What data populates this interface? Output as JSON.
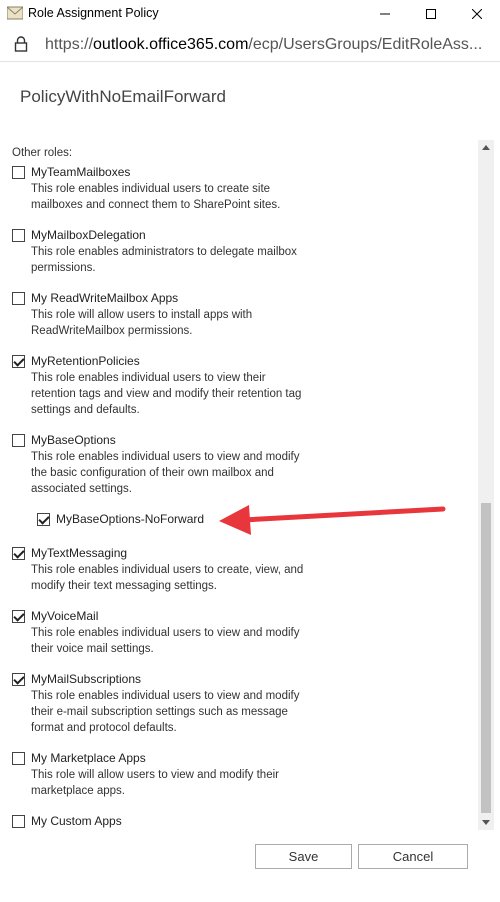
{
  "window": {
    "title": "Role Assignment Policy",
    "minimize_icon": "minimize-icon",
    "maximize_icon": "maximize-icon",
    "close_icon": "close-icon"
  },
  "address_bar": {
    "protocol": "https://",
    "host": "outlook.office365.com",
    "path": "/ecp/UsersGroups/EditRoleAss..."
  },
  "policy_name": "PolicyWithNoEmailForward",
  "section_label": "Other roles:",
  "roles": [
    {
      "name": "MyTeamMailboxes",
      "desc": "This role enables individual users to create site mailboxes and connect them to SharePoint sites.",
      "checked": false
    },
    {
      "name": "MyMailboxDelegation",
      "desc": "This role enables administrators to delegate mailbox permissions.",
      "checked": false
    },
    {
      "name": "My ReadWriteMailbox Apps",
      "desc": "This role will allow users to install apps with ReadWriteMailbox permissions.",
      "checked": false
    },
    {
      "name": "MyRetentionPolicies",
      "desc": "This role enables individual users to view their retention tags and view and modify their retention tag settings and defaults.",
      "checked": true
    },
    {
      "name": "MyBaseOptions",
      "desc": "This role enables individual users to view and modify the basic configuration of their own mailbox and associated settings.",
      "checked": false
    },
    {
      "name": "MyBaseOptions-NoForward",
      "desc": "",
      "checked": true
    },
    {
      "name": "MyTextMessaging",
      "desc": "This role enables individual users to create, view, and modify their text messaging settings.",
      "checked": true
    },
    {
      "name": "MyVoiceMail",
      "desc": "This role enables individual users to view and modify their voice mail settings.",
      "checked": true
    },
    {
      "name": "MyMailSubscriptions",
      "desc": "This role enables individual users to view and modify their e-mail subscription settings such as message format and protocol defaults.",
      "checked": true
    },
    {
      "name": "My Marketplace Apps",
      "desc": "This role will allow users to view and modify their marketplace apps.",
      "checked": false
    },
    {
      "name": "My Custom Apps",
      "desc": "",
      "checked": false
    }
  ],
  "annotation": {
    "color": "#e8373c"
  },
  "buttons": {
    "save": "Save",
    "cancel": "Cancel"
  }
}
